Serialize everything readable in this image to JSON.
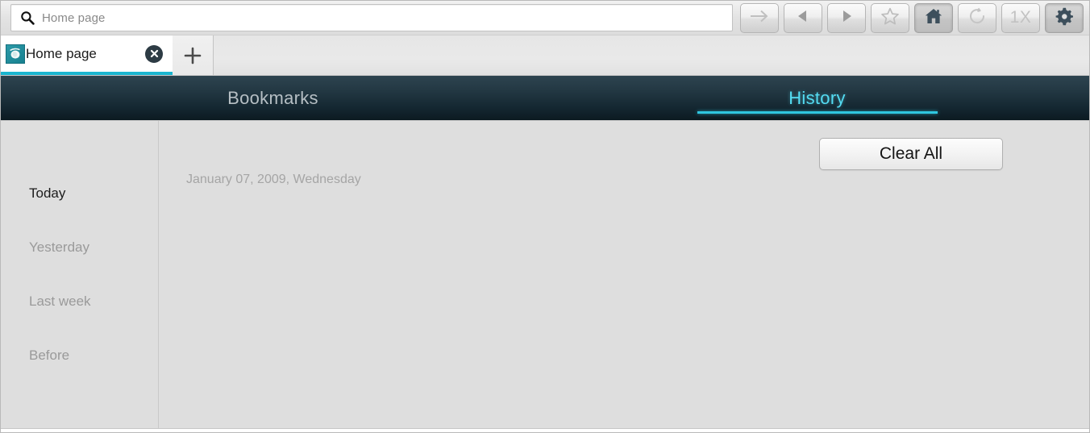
{
  "window": {
    "accent_color": "#2fc6e0",
    "navbar_dark": "#152832",
    "content_bg": "#dedede"
  },
  "toolbar": {
    "address": {
      "value": "Home page",
      "placeholder": "Home page",
      "icon": "search-icon"
    },
    "buttons": [
      {
        "name": "go-button",
        "icon": "arrow-right-icon",
        "label": "",
        "state": "disabled"
      },
      {
        "name": "back-button",
        "icon": "triangle-left-icon",
        "label": "",
        "state": "enabled"
      },
      {
        "name": "forward-button",
        "icon": "triangle-right-icon",
        "label": "",
        "state": "enabled"
      },
      {
        "name": "bookmark-button",
        "icon": "star-icon",
        "label": "",
        "state": "enabled"
      },
      {
        "name": "home-button",
        "icon": "home-icon",
        "label": "",
        "state": "pressed"
      },
      {
        "name": "reload-button",
        "icon": "refresh-icon",
        "label": "",
        "state": "disabled"
      },
      {
        "name": "zoom-button",
        "icon": "zoom-level-icon",
        "label": "1X",
        "state": "disabled"
      },
      {
        "name": "settings-button",
        "icon": "gear-icon",
        "label": "",
        "state": "pressed"
      }
    ]
  },
  "tabstrip": {
    "tabs": [
      {
        "title": "Home page",
        "favicon": "globe-icon",
        "close_label": "✕",
        "active": true
      }
    ],
    "new_tab_label": "+"
  },
  "nav": {
    "tabs": [
      {
        "label": "Bookmarks",
        "active": false
      },
      {
        "label": "History",
        "active": true
      }
    ]
  },
  "history": {
    "clear_all_label": "Clear All",
    "date_header": "January 07, 2009, Wednesday",
    "sidebar": [
      {
        "label": "Today",
        "active": true
      },
      {
        "label": "Yesterday",
        "active": false
      },
      {
        "label": "Last week",
        "active": false
      },
      {
        "label": "Before",
        "active": false
      }
    ],
    "entries": []
  }
}
